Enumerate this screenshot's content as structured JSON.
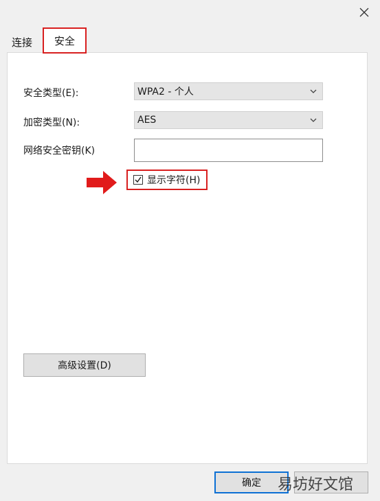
{
  "tabs": [
    {
      "label": "连接",
      "active": false
    },
    {
      "label": "安全",
      "active": true
    }
  ],
  "form": {
    "security_type_label": "安全类型(E):",
    "security_type_value": "WPA2 - 个人",
    "encryption_type_label": "加密类型(N):",
    "encryption_type_value": "AES",
    "network_key_label": "网络安全密钥(K)",
    "network_key_value": ""
  },
  "show_chars": {
    "label": "显示字符(H)",
    "checked": true
  },
  "advanced_button_label": "高级设置(D)",
  "ok_button_label": "确定",
  "watermark": "易坊好文馆",
  "colors": {
    "highlight": "#d81e1e",
    "focus": "#0a6fd4"
  }
}
